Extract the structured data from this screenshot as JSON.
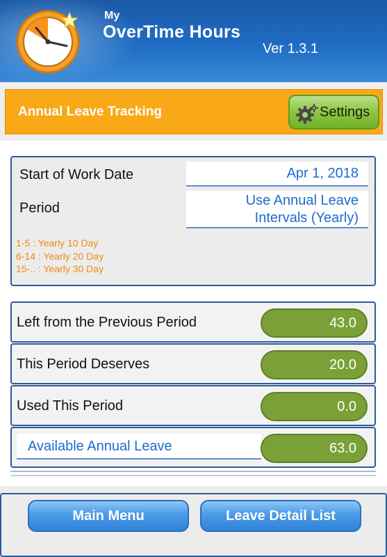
{
  "header": {
    "app_prefix": "My",
    "app_name": "OverTime Hours",
    "version": "Ver 1.3.1"
  },
  "titlebar": {
    "title": "Annual Leave Tracking",
    "settings_label": "Settings"
  },
  "info": {
    "start_label": "Start of Work Date",
    "start_value": "Apr 1, 2018",
    "period_label": "Period",
    "period_value_line1": "Use Annual Leave",
    "period_value_line2": "Intervals (Yearly)",
    "legend": [
      "1-5  : Yearly 10 Day",
      "6-14 : Yearly 20 Day",
      "15-.. : Yearly 30 Day"
    ]
  },
  "rows": [
    {
      "label": "Left from the Previous Period",
      "value": "43.0"
    },
    {
      "label": "This Period Deserves",
      "value": "20.0"
    },
    {
      "label": "Used This Period",
      "value": "0.0"
    },
    {
      "label": "Available Annual Leave",
      "value": "63.0"
    }
  ],
  "bottom": {
    "main_menu_label": "Main Menu",
    "leave_detail_label": "Leave Detail List"
  },
  "colors": {
    "header_blue": "#1f6cc4",
    "title_orange": "#f9a818",
    "pill_green": "#7aa137",
    "link_blue": "#1e6ad0",
    "legend_orange": "#f08a10"
  }
}
